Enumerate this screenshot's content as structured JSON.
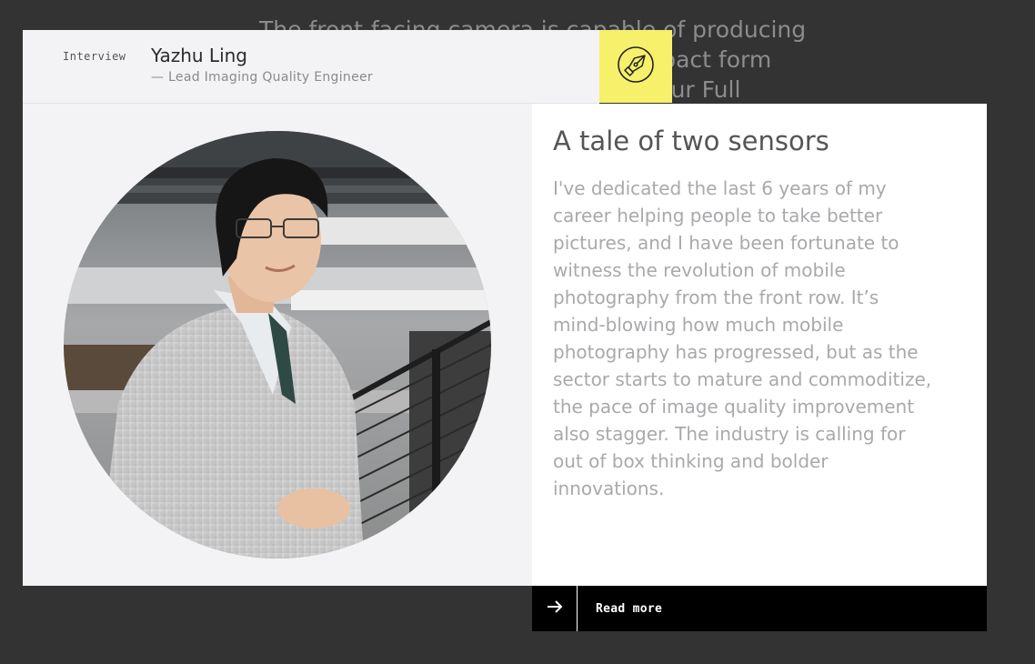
{
  "background_text": {
    "lines": [
      "The front-facing camera is capable of producing",
      "                                              a compact form",
      "                                                into our Full"
    ]
  },
  "card": {
    "tag": "Interview",
    "person_name": "Yazhu Ling",
    "person_role": "— Lead Imaging Quality Engineer",
    "icon": "fountain-pen-icon",
    "photo_alt": "Portrait of Yazhu Ling",
    "headline": "A tale of two sensors",
    "body_lines": [
      "I've dedicated the last 6 years of my",
      "career helping people to take better",
      "pictures, and I have been fortunate to",
      "witness the revolution of mobile",
      "photography from the front row. It’s",
      "mind-blowing how much mobile",
      "photography has progressed, but as the",
      "sector starts to mature and commoditize,",
      "the pace of image quality improvement",
      "also stagger. The industry is calling for",
      "out of box thinking and bolder",
      "innovations."
    ],
    "read_more_label": "Read more",
    "read_more_icon": "arrow-right-icon"
  },
  "colors": {
    "page_background": "#333333",
    "badge_yellow": "#f7f06b",
    "panel_grey": "#f3f3f5",
    "cta_black": "#000000"
  }
}
